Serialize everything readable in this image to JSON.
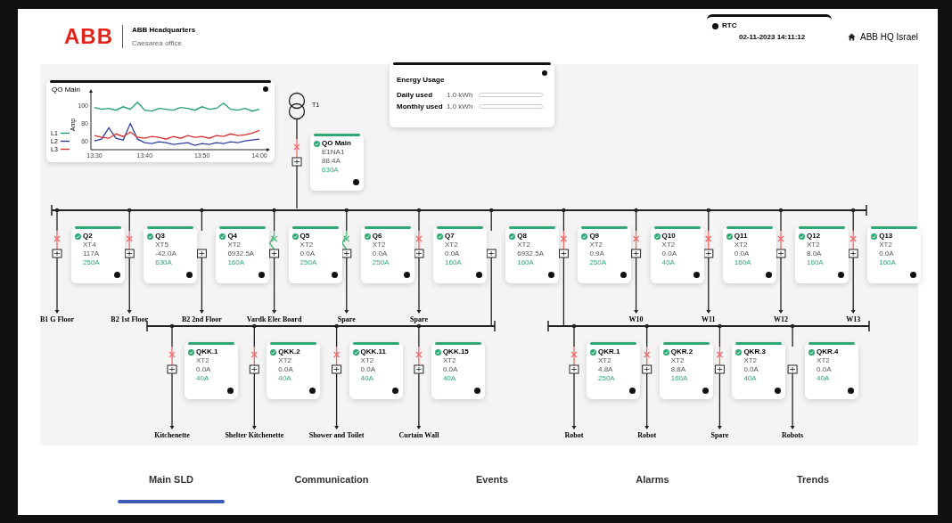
{
  "header": {
    "logo": "ABB",
    "site": "ABB Headquarters",
    "office": "Caesarea office",
    "rtc": {
      "label": "RTC",
      "datetime": "02-11-2023 14:11:12"
    },
    "location": "ABB HQ Israel"
  },
  "energy_usage": {
    "title": "Energy Usage",
    "rows": [
      {
        "label": "Daily used",
        "reading": "1.0 kWh",
        "level": 0.0
      },
      {
        "label": "Monthly used",
        "reading": "1.0 kWh",
        "level": 0.0
      }
    ]
  },
  "trend": {
    "title": "QO Main",
    "chart_data": {
      "type": "line",
      "ylabel": "Amp",
      "categories": [
        "13:30",
        null,
        null,
        null,
        null,
        null,
        null,
        "13:40",
        null,
        null,
        null,
        null,
        null,
        null,
        null,
        "13:50",
        null,
        null,
        null,
        null,
        null,
        null,
        null,
        "14:00"
      ],
      "ylim": [
        50,
        115
      ],
      "yticks": [
        60,
        80,
        100
      ],
      "legend": true,
      "series": [
        {
          "name": "L1",
          "color": "#1f9e6e",
          "values": [
            98,
            96,
            97,
            95,
            99,
            96,
            104,
            95,
            94,
            97,
            96,
            95,
            98,
            97,
            95,
            99,
            96,
            97,
            103,
            96,
            95,
            97,
            94,
            96
          ]
        },
        {
          "name": "L2",
          "color": "#2f3f9e",
          "values": [
            60,
            62,
            75,
            63,
            61,
            80,
            62,
            58,
            57,
            59,
            58,
            56,
            57,
            58,
            55,
            57,
            56,
            58,
            57,
            59,
            58,
            60,
            61,
            62
          ]
        },
        {
          "name": "L3",
          "color": "#d93030",
          "values": [
            66,
            64,
            63,
            68,
            65,
            70,
            64,
            63,
            65,
            64,
            62,
            65,
            63,
            66,
            64,
            65,
            63,
            66,
            65,
            68,
            66,
            67,
            69,
            72
          ]
        }
      ]
    }
  },
  "transformer": {
    "label": "T1"
  },
  "main_breaker": {
    "name": "QO Main",
    "model": "E1NA1",
    "current": "88.4A",
    "rating": "630A",
    "breaker": {
      "kind": "tripped"
    }
  },
  "feeders": [
    {
      "name": "Q2",
      "model": "XT4",
      "current": "117A",
      "rating": "250A",
      "breaker": {
        "kind": "tripped"
      },
      "load": "B1 G Floor"
    },
    {
      "name": "Q3",
      "model": "XT5",
      "current": "-42.0A",
      "rating": "630A",
      "breaker": {
        "kind": "tripped"
      },
      "load": "B2 1st Floor"
    },
    {
      "name": "Q4",
      "model": "XT2",
      "current": "6932.5A",
      "rating": "160A",
      "breaker": {
        "kind": "none"
      },
      "load": "B2 2nd Floor"
    },
    {
      "name": "Q5",
      "model": "XT2",
      "current": "0.0A",
      "rating": "250A",
      "breaker": {
        "kind": "closed"
      },
      "load": "Vardk Elec Board"
    },
    {
      "name": "Q6",
      "model": "XT2",
      "current": "0.0A",
      "rating": "250A",
      "breaker": {
        "kind": "closed"
      },
      "load": "Spare"
    },
    {
      "name": "Q7",
      "model": "XT2",
      "current": "0.0A",
      "rating": "160A",
      "breaker": {
        "kind": "tripped"
      },
      "load": "Spare"
    },
    {
      "name": "Q8",
      "model": "XT2",
      "current": "6932.5A",
      "rating": "160A",
      "breaker": {
        "kind": "none"
      }
    },
    {
      "name": "Q9",
      "model": "XT2",
      "current": "0.9A",
      "rating": "250A",
      "breaker": {
        "kind": "tripped"
      }
    },
    {
      "name": "Q10",
      "model": "XT2",
      "current": "0.0A",
      "rating": "40A",
      "breaker": {
        "kind": "tripped"
      },
      "load": "W10"
    },
    {
      "name": "Q11",
      "model": "XT2",
      "current": "0.0A",
      "rating": "160A",
      "breaker": {
        "kind": "tripped"
      },
      "load": "W11"
    },
    {
      "name": "Q12",
      "model": "XT2",
      "current": "8.0A",
      "rating": "160A",
      "breaker": {
        "kind": "tripped"
      },
      "load": "W12"
    },
    {
      "name": "Q13",
      "model": "XT2",
      "current": "0.0A",
      "rating": "160A",
      "breaker": {
        "kind": "tripped"
      },
      "load": "W13"
    }
  ],
  "sub_boards": [
    {
      "feeders": [
        {
          "name": "QKK.1",
          "model": "XT2",
          "current": "0.0A",
          "rating": "40A",
          "breaker": {
            "kind": "tripped"
          },
          "load": "Kitchenette"
        },
        {
          "name": "QKK.2",
          "model": "XT2",
          "current": "0.0A",
          "rating": "40A",
          "breaker": {
            "kind": "tripped"
          },
          "load": "Shelter Kitchenette"
        },
        {
          "name": "QKK.11",
          "model": "XT2",
          "current": "0.0A",
          "rating": "40A",
          "breaker": {
            "kind": "tripped"
          },
          "load": "Shower and Toilet"
        },
        {
          "name": "QKK.15",
          "model": "XT2",
          "current": "0.0A",
          "rating": "40A",
          "breaker": {
            "kind": "tripped"
          },
          "load": "Curtain Wall"
        }
      ]
    },
    {
      "feeders": [
        {
          "name": "QKR.1",
          "model": "XT2",
          "current": "4.8A",
          "rating": "250A",
          "breaker": {
            "kind": "tripped"
          },
          "load": "Robot"
        },
        {
          "name": "QKR.2",
          "model": "XT2",
          "current": "8.8A",
          "rating": "160A",
          "breaker": {
            "kind": "tripped"
          },
          "load": "Robot"
        },
        {
          "name": "QKR.3",
          "model": "XT2",
          "current": "0.0A",
          "rating": "40A",
          "breaker": {
            "kind": "tripped"
          },
          "load": "Spare"
        },
        {
          "name": "QKR.4",
          "model": "XT2",
          "current": "0.0A",
          "rating": "40A",
          "breaker": {
            "kind": "none"
          },
          "load": "Robots"
        }
      ]
    }
  ],
  "tabs": [
    {
      "label": "Main SLD",
      "selected": true
    },
    {
      "label": "Communication",
      "selected": false
    },
    {
      "label": "Events",
      "selected": false
    },
    {
      "label": "Alarms",
      "selected": false
    },
    {
      "label": "Trends",
      "selected": false
    }
  ]
}
